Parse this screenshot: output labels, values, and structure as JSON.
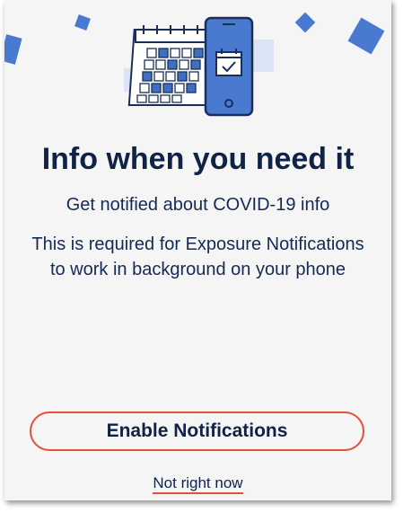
{
  "onboarding": {
    "title": "Info when you need it",
    "subtitle": "Get notified about COVID-19 info",
    "description": "This is required for Exposure Notifications to work in background on your phone",
    "primary_button": "Enable Notifications",
    "secondary_link": "Not right now"
  },
  "illustration": {
    "icons": [
      "calendar-icon",
      "phone-icon",
      "calendar-check-icon"
    ]
  },
  "colors": {
    "accent": "#e2503a",
    "brand_blue": "#4a7ad0",
    "navy": "#0f2346",
    "background": "#f5f5f5"
  }
}
